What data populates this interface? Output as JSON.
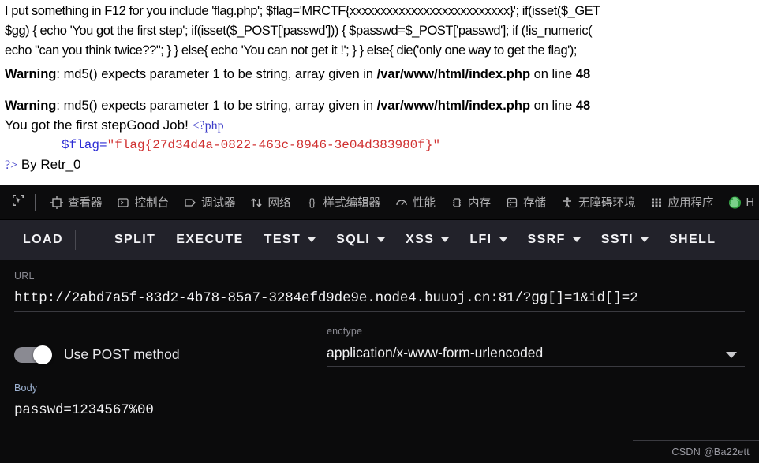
{
  "page": {
    "source_lines": [
      "I put something in F12 for you include 'flag.php'; $flag='MRCTF{xxxxxxxxxxxxxxxxxxxxxxxxxx}'; if(isset($_GET",
      "$gg) { echo 'You got the first step'; if(isset($_POST['passwd'])) { $passwd=$_POST['passwd']; if (!is_numeric(",
      "echo \"can you think twice??\"; } } else{ echo 'You can not get it !'; } } else{ die('only one way to get the flag');"
    ],
    "warnings": [
      {
        "label": "Warning",
        "colon": ": ",
        "text_before": "md5() expects parameter 1 to be string, array given in ",
        "file": "/var/www/html/index.php",
        "text_middle": " on line ",
        "line_number": "48"
      },
      {
        "label": "Warning",
        "colon": ": ",
        "text_before": "md5() expects parameter 1 to be string, array given in ",
        "file": "/var/www/html/index.php",
        "text_middle": " on line ",
        "line_number": "48"
      }
    ],
    "result_line": "You got the first stepGood Job! ",
    "php_open_tag": "<?php",
    "flag_assignment": {
      "variable": "$flag=",
      "string": "\"flag{27d34d4a-0822-463c-8946-3e04d383980f}\"",
      "variable_color": "#2b2bd4",
      "string_color": "#d03030"
    },
    "php_close_tag": "?>",
    "author_credit": " By Retr_0"
  },
  "devtools": {
    "picker_icon": "element-picker-icon",
    "tabs": [
      {
        "icon": "inspector-icon",
        "label": "查看器"
      },
      {
        "icon": "console-icon",
        "label": "控制台"
      },
      {
        "icon": "debugger-icon",
        "label": "调试器"
      },
      {
        "icon": "network-icon",
        "label": "网络"
      },
      {
        "icon": "style-editor-icon",
        "label": "样式编辑器"
      },
      {
        "icon": "performance-icon",
        "label": "性能"
      },
      {
        "icon": "memory-icon",
        "label": "内存"
      },
      {
        "icon": "storage-icon",
        "label": "存储"
      },
      {
        "icon": "accessibility-icon",
        "label": "无障碍环境"
      },
      {
        "icon": "application-icon",
        "label": "应用程序"
      },
      {
        "icon": "hackbar-icon",
        "label": "H"
      }
    ]
  },
  "hackbar": {
    "menu": [
      {
        "label": "LOAD",
        "has_caret": false,
        "split_caret": true
      },
      {
        "label": "SPLIT",
        "has_caret": false,
        "split_caret": false
      },
      {
        "label": "EXECUTE",
        "has_caret": false,
        "split_caret": false
      },
      {
        "label": "TEST",
        "has_caret": true,
        "split_caret": false
      },
      {
        "label": "SQLI",
        "has_caret": true,
        "split_caret": false
      },
      {
        "label": "XSS",
        "has_caret": true,
        "split_caret": false
      },
      {
        "label": "LFI",
        "has_caret": true,
        "split_caret": false
      },
      {
        "label": "SSRF",
        "has_caret": true,
        "split_caret": false
      },
      {
        "label": "SSTI",
        "has_caret": true,
        "split_caret": false
      },
      {
        "label": "SHELL",
        "has_caret": false,
        "split_caret": false
      }
    ],
    "url": {
      "label": "URL",
      "value": "http://2abd7a5f-83d2-4b78-85a7-3284efd9de9e.node4.buuoj.cn:81/?gg[]=1&id[]=2"
    },
    "post_toggle": {
      "label": "Use POST method",
      "enabled": true
    },
    "enctype": {
      "label": "enctype",
      "value": "application/x-www-form-urlencoded"
    },
    "body": {
      "label": "Body",
      "value": "passwd=1234567%00"
    }
  },
  "watermark": {
    "text": "CSDN @Ba22ett"
  },
  "colors": {
    "devtools_bg": "#0c0c0d",
    "hackbar_menu_bg": "#22222a",
    "hackbar_body_bg": "#0b0b0c",
    "tab_text": "#b1b1b3",
    "field_label": "#8a8a92",
    "field_value": "#f2f2f4"
  }
}
